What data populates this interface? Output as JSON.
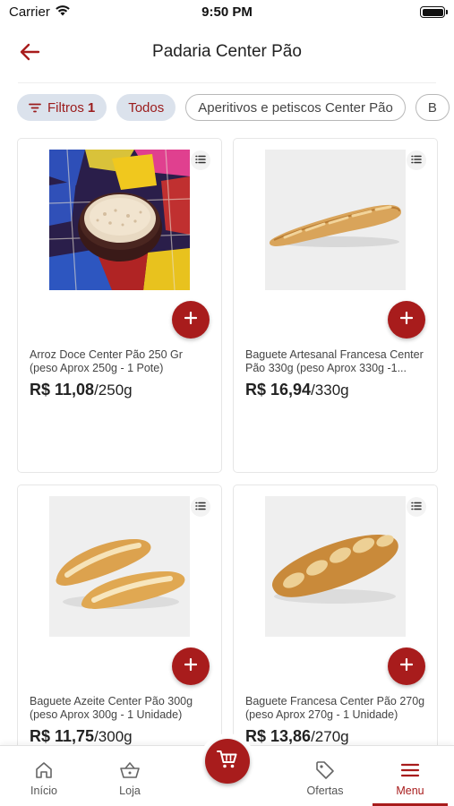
{
  "status_bar": {
    "carrier": "Carrier",
    "time": "9:50 PM"
  },
  "header": {
    "title": "Padaria Center Pão"
  },
  "colors": {
    "accent": "#a81c1c",
    "chip_filled_bg": "#dbe2ec"
  },
  "chips": [
    {
      "label": "Filtros",
      "count": "1",
      "icon": "filter-icon"
    },
    {
      "label": "Todos"
    },
    {
      "label": "Aperitivos e petiscos Center Pão"
    },
    {
      "label": "B"
    }
  ],
  "products": [
    {
      "name": "Arroz Doce Center Pão 250 Gr (peso Aprox 250g - 1 Pote)",
      "price": "R$ 11,08",
      "unit": "/250g"
    },
    {
      "name": "Baguete Artesanal Francesa Center Pão 330g (peso Aprox 330g -1...",
      "price": "R$ 16,94",
      "unit": "/330g"
    },
    {
      "name": "Baguete Azeite Center Pão 300g (peso Aprox 300g - 1 Unidade)",
      "price": "R$ 11,75",
      "unit": "/300g"
    },
    {
      "name": "Baguete Francesa Center Pão 270g (peso Aprox 270g - 1 Unidade)",
      "price": "R$ 13,86",
      "unit": "/270g"
    }
  ],
  "bottom_nav": {
    "items": [
      {
        "label": "Início",
        "icon": "home-icon"
      },
      {
        "label": "Loja",
        "icon": "basket-icon"
      },
      {
        "label": "Ofertas",
        "icon": "tag-icon"
      },
      {
        "label": "Menu",
        "icon": "hamburger-menu-icon",
        "active": true
      }
    ],
    "cart_icon": "cart-icon"
  }
}
